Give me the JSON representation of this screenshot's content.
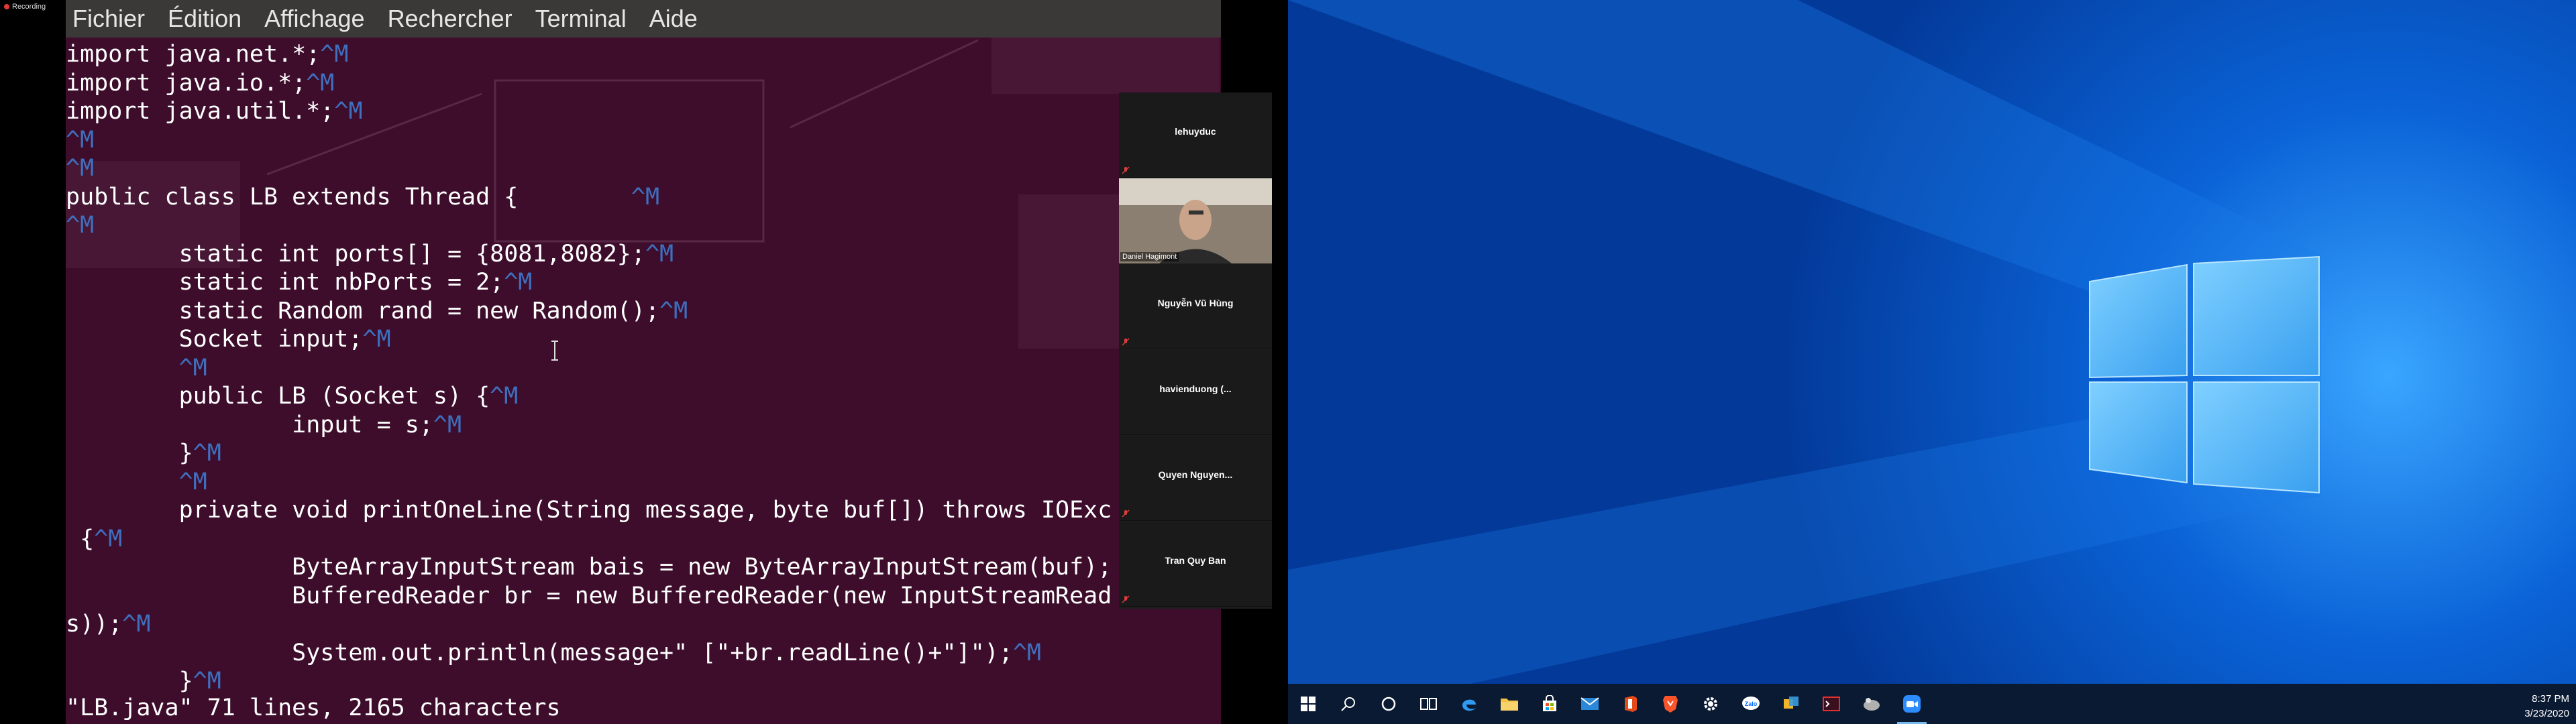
{
  "recording_label": "Recording",
  "terminal": {
    "menu": [
      "Fichier",
      "Édition",
      "Affichage",
      "Rechercher",
      "Terminal",
      "Aide"
    ],
    "code_lines": [
      [
        "import java.net.*;",
        "^M"
      ],
      [
        "import java.io.*;",
        "^M"
      ],
      [
        "import java.util.*;",
        "^M"
      ],
      [
        "",
        "^M"
      ],
      [
        "",
        "^M"
      ],
      [
        "public class LB extends Thread {        ",
        "^M"
      ],
      [
        "",
        "^M"
      ],
      [
        "        static int ports[] = {8081,8082};",
        "^M"
      ],
      [
        "        static int nbPorts = 2;",
        "^M"
      ],
      [
        "        static Random rand = new Random();",
        "^M"
      ],
      [
        "        Socket input;",
        "^M"
      ],
      [
        "        ",
        "^M"
      ],
      [
        "        public LB (Socket s) {",
        "^M"
      ],
      [
        "                input = s;",
        "^M"
      ],
      [
        "        }",
        "^M"
      ],
      [
        "        ",
        "^M"
      ],
      [
        "        private void printOneLine(String message, byte buf[]) throws IOExc",
        ""
      ],
      [
        " {",
        "^M"
      ],
      [
        "                ByteArrayInputStream bais = new ByteArrayInputStream(buf);",
        ""
      ],
      [
        "                BufferedReader br = new BufferedReader(new InputStreamRead",
        ""
      ],
      [
        "s));",
        "^M"
      ],
      [
        "                System.out.println(message+\" [\"+br.readLine()+\"]\");",
        "^M"
      ],
      [
        "        }",
        "^M"
      ]
    ],
    "status_line": "\"LB.java\" 71 lines, 2165 characters"
  },
  "zoom": {
    "participants": [
      {
        "name": "lehuyduc",
        "muted": true,
        "video": false
      },
      {
        "name": "Daniel Hagimont",
        "muted": false,
        "video": true
      },
      {
        "name": "Nguyễn Vũ Hùng",
        "muted": true,
        "video": false
      },
      {
        "name": "havienduong  (...",
        "muted": false,
        "video": false
      },
      {
        "name": "Quyen  Nguyen...",
        "muted": true,
        "video": false
      },
      {
        "name": "Tran Quy Ban",
        "muted": true,
        "video": false
      }
    ]
  },
  "taskbar": {
    "apps": [
      "windows-start",
      "search",
      "cortana",
      "task-view",
      "edge",
      "file-explorer",
      "store",
      "mail",
      "office",
      "brave",
      "settings",
      "zalo",
      "sticky",
      "terminal-app",
      "linux-app",
      "zoom"
    ],
    "active": "zoom",
    "time": "8:37 PM",
    "date": "3/23/2020"
  },
  "colors": {
    "terminal_bg": "#3d0d2b",
    "desktop_blue": "#0a58c8",
    "taskbar": "#0b1a33"
  }
}
